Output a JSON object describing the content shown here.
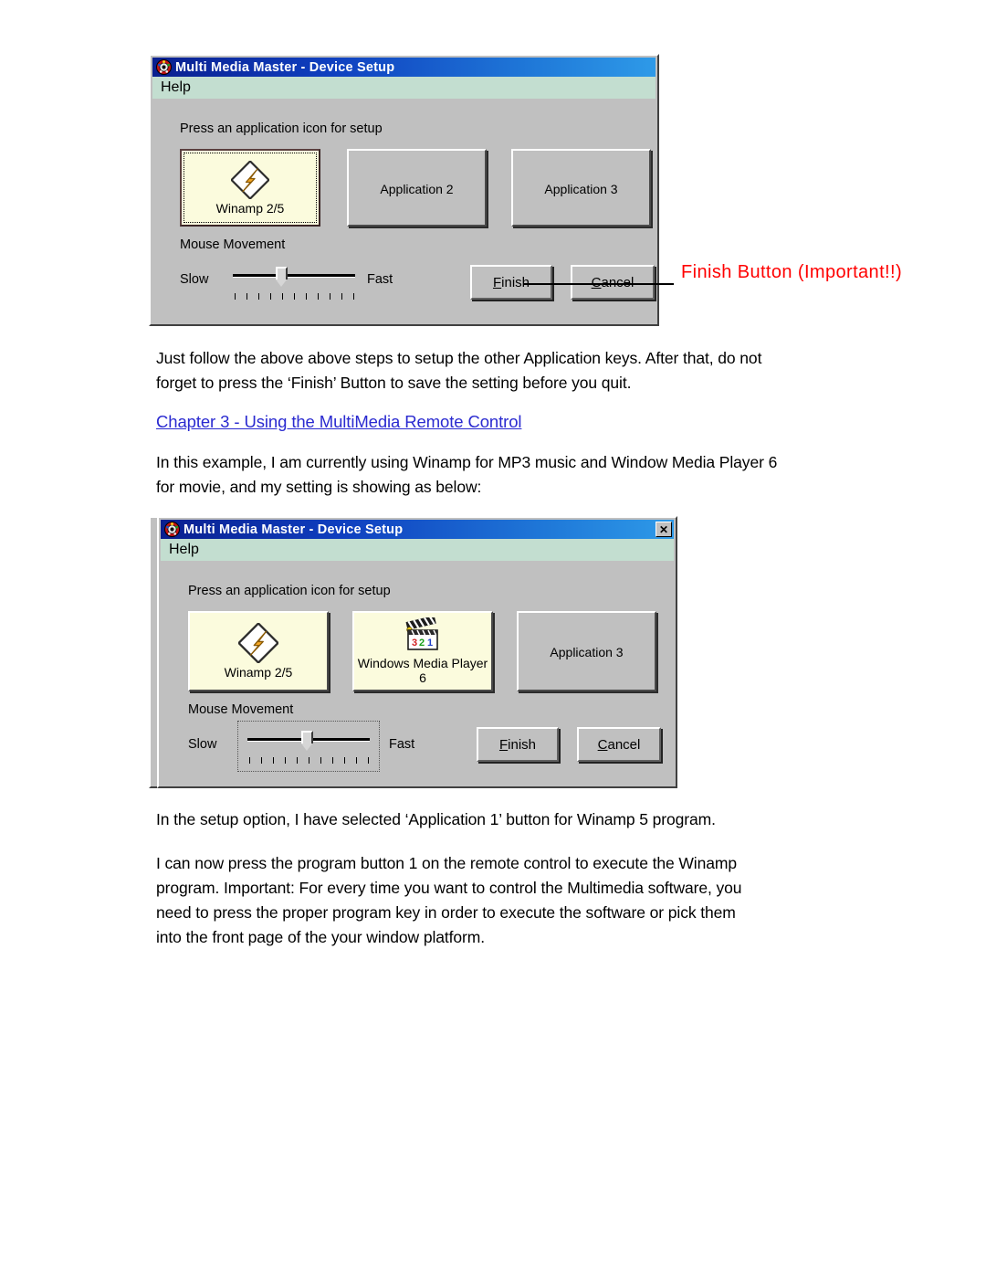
{
  "dialog1": {
    "title": "Multi Media Master - Device Setup",
    "title_icon": "remote-control-icon",
    "menu": [
      {
        "label": "Help"
      }
    ],
    "hint": "Press an application icon for setup",
    "app_buttons": [
      {
        "caption": "Winamp 2/5",
        "icon": "winamp-lightning-icon",
        "selected": true
      },
      {
        "caption": "Application 2",
        "icon": "",
        "selected": false
      },
      {
        "caption": "Application 3",
        "icon": "",
        "selected": false
      }
    ],
    "mouse_group_label": "Mouse Movement",
    "slider": {
      "slow_label": "Slow",
      "fast_label": "Fast",
      "ticks": 11,
      "value_index": 4
    },
    "finish_label": "Finish",
    "finish_accel": "F",
    "cancel_label": "Cancel",
    "cancel_accel": "C"
  },
  "annotation": {
    "text": "Finish Button (Important!!)",
    "color": "#ff0000"
  },
  "body": {
    "para1_line1": "Just follow the above above steps to setup the other Application keys. After that, do not",
    "para1_line2": "forget to press the ‘Finish’ Button to save the setting before you quit.",
    "chapter_heading": "Chapter 3 - Using the MultiMedia Remote Control",
    "para2_line1": "In this example, I am currently using Winamp for MP3 music and Window Media Player 6",
    "para2_line2": "for movie, and my setting is showing as below:",
    "para3": "In the setup option, I have selected ‘Application 1’ button for Winamp 5 program.",
    "para4_line1": "I can now press the program button 1 on the remote control to execute the Winamp",
    "para4_line2": "program. Important: For every time you want to control the Multimedia software, you",
    "para4_line3": "need to press the proper program key in order to execute the software or pick them",
    "para4_line4": "into the front page of the your window platform."
  },
  "dialog2": {
    "title": "Multi Media Master - Device Setup",
    "title_icon": "remote-control-icon",
    "close_label": "✕",
    "menu": [
      {
        "label": "Help"
      }
    ],
    "hint": "Press an application icon for setup",
    "app_buttons": [
      {
        "caption": "Winamp 2/5",
        "icon": "winamp-lightning-icon",
        "selected": true
      },
      {
        "caption": "Windows Media Player\n6",
        "icon": "clapperboard-321-icon",
        "selected": true
      },
      {
        "caption": "Application 3",
        "icon": "",
        "selected": false
      }
    ],
    "mouse_group_label": "Mouse Movement",
    "slider": {
      "slow_label": "Slow",
      "fast_label": "Fast",
      "ticks": 11,
      "value_index": 5
    },
    "finish_label": "Finish",
    "finish_accel": "F",
    "cancel_label": "Cancel",
    "cancel_accel": "C"
  },
  "colors": {
    "dialog_face": "#c0c0c0",
    "menubar": "#c3ded0",
    "selected_button": "#fbfbdd",
    "title_gradient_start": "#0a1f8f",
    "title_gradient_end": "#2e9ae8",
    "link": "#2a2ad0",
    "annotation": "#ff0000"
  }
}
